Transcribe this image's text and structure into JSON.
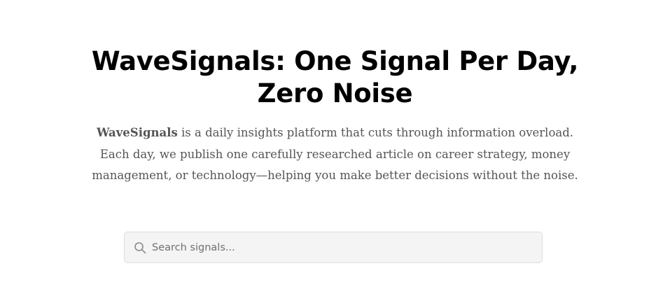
{
  "hero": {
    "title": "WaveSignals: One Signal Per Day, Zero Noise",
    "description": {
      "brand": "WaveSignals",
      "text": " is a daily insights platform that cuts through information overload. Each day, we publish one carefully researched article on career strategy, money management, or technology—helping you make better decisions without the noise."
    }
  },
  "search": {
    "placeholder": "Search signals...",
    "value": "",
    "icon": "search-icon"
  }
}
